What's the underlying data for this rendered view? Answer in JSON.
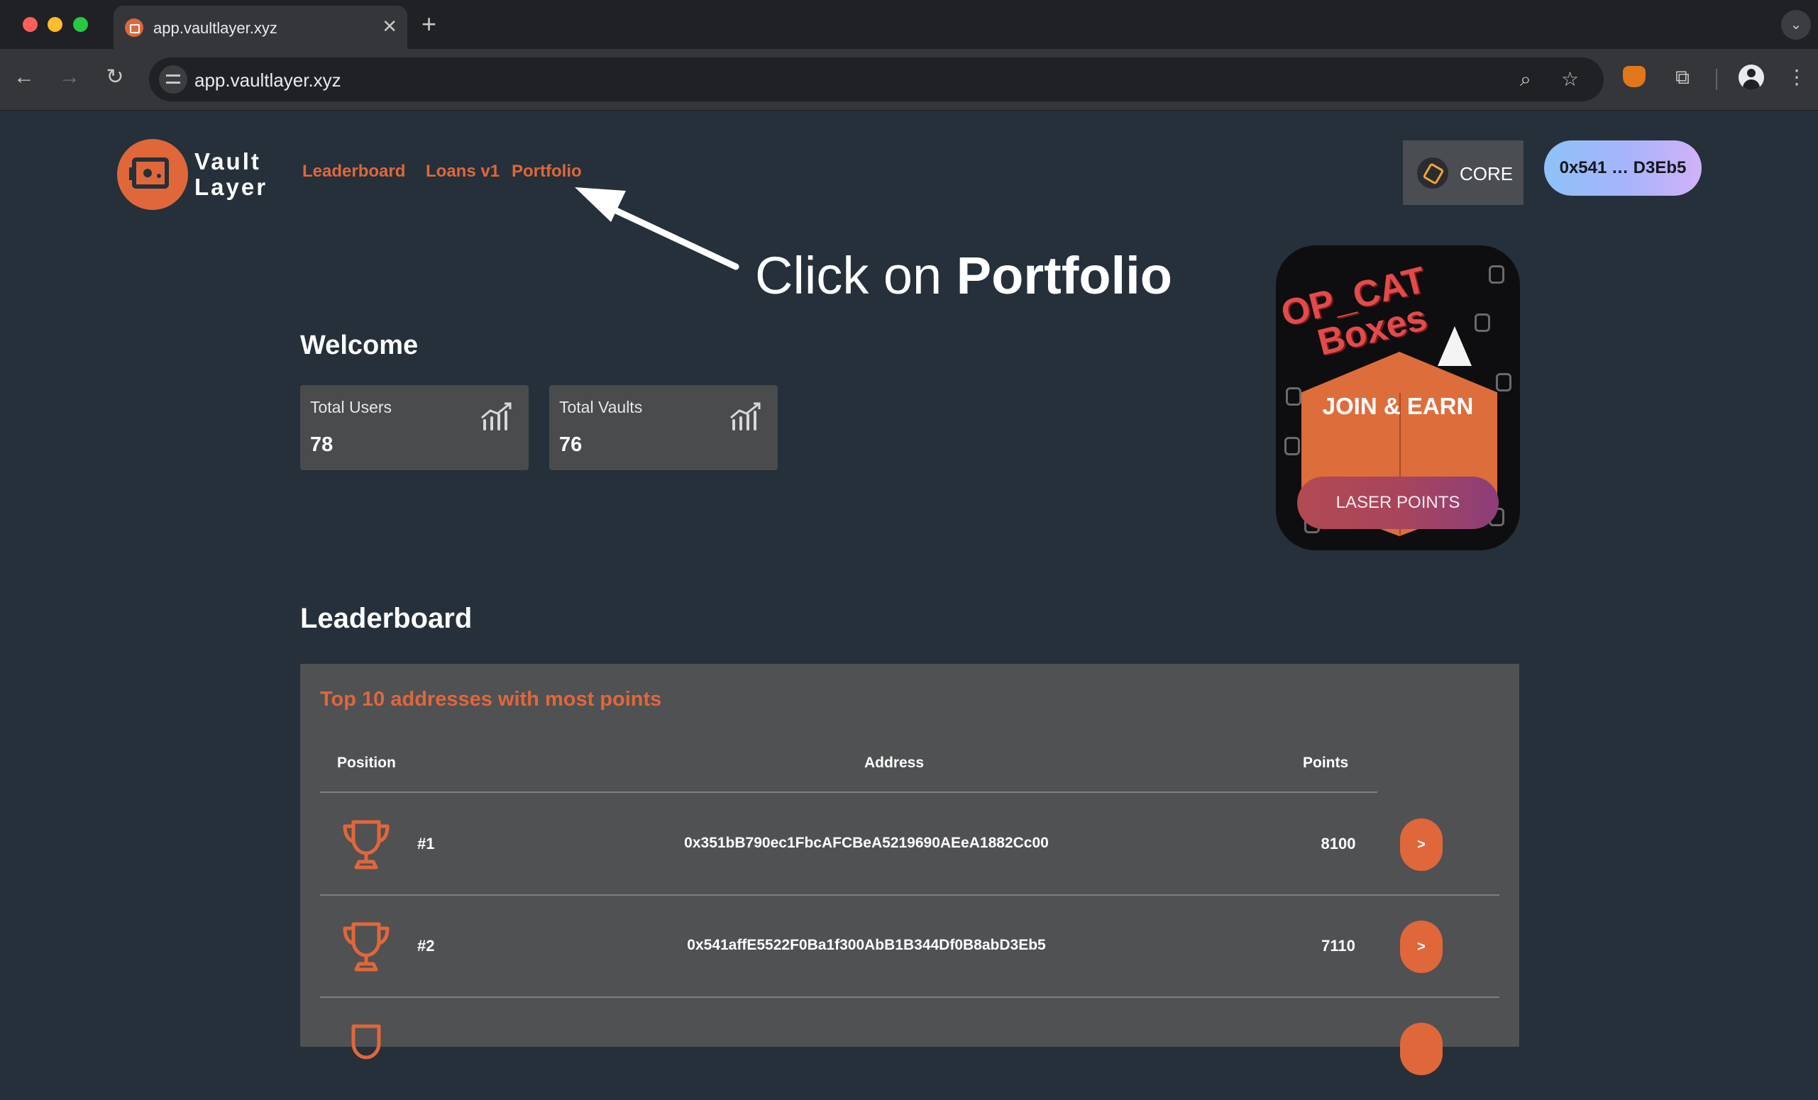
{
  "browser": {
    "tab_title": "app.vaultlayer.xyz",
    "url": "app.vaultlayer.xyz",
    "colors": {
      "red": "#ff5f57",
      "yellow": "#febc2e",
      "green": "#28c840"
    }
  },
  "header": {
    "logo_line1": "Vault",
    "logo_line2": "Layer",
    "nav": [
      "Leaderboard",
      "Loans v1",
      "Portfolio"
    ],
    "network_label": "CORE",
    "wallet_label": "0x541 … D3Eb5",
    "accent_color": "#e0673a"
  },
  "annotation": {
    "prefix": "Click on ",
    "emphasis": "Portfolio"
  },
  "welcome": {
    "title": "Welcome",
    "stats": [
      {
        "label": "Total Users",
        "value": "78"
      },
      {
        "label": "Total Vaults",
        "value": "76"
      }
    ]
  },
  "promo": {
    "title_line1": "OP_CAT",
    "title_line2": "Boxes",
    "tagline": "JOIN & EARN",
    "button": "LASER POINTS"
  },
  "leaderboard": {
    "title": "Leaderboard",
    "subtitle": "Top 10 addresses with most points",
    "columns": [
      "Position",
      "Address",
      "Points"
    ],
    "rows": [
      {
        "position": "#1",
        "address": "0x351bB790ec1FbcAFCBeA5219690AEeA1882Cc00",
        "points": "8100",
        "action": ">"
      },
      {
        "position": "#2",
        "address": "0x541affE5522F0Ba1f300AbB1B344Df0B8abD3Eb5",
        "points": "7110",
        "action": ">"
      }
    ]
  }
}
